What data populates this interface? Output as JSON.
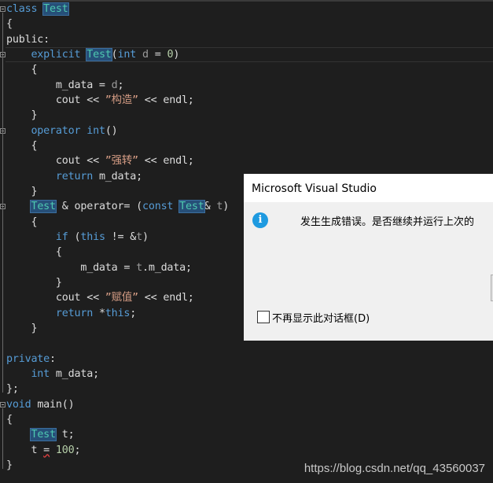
{
  "editor": {
    "lines": [
      [
        [
          "class ",
          "kw"
        ],
        [
          "Test",
          "ty hl"
        ]
      ],
      [
        [
          "{",
          ""
        ]
      ],
      [
        [
          "public",
          ""
        ],
        [
          ":",
          ""
        ]
      ],
      [
        [
          "    explicit ",
          "kw"
        ],
        [
          "Test",
          "ty hl"
        ],
        [
          "(",
          ""
        ],
        [
          "int ",
          "kw"
        ],
        [
          "d",
          "par"
        ],
        [
          " = ",
          ""
        ],
        [
          "0",
          "num"
        ],
        [
          ")",
          ""
        ]
      ],
      [
        [
          "    {",
          ""
        ]
      ],
      [
        [
          "        m_data = ",
          ""
        ],
        [
          "d",
          "par"
        ],
        [
          ";",
          ""
        ]
      ],
      [
        [
          "        cout << ",
          ""
        ],
        [
          "”构造”",
          "str"
        ],
        [
          " << endl;",
          ""
        ]
      ],
      [
        [
          "    }",
          ""
        ]
      ],
      [
        [
          "    operator ",
          "kw"
        ],
        [
          "int",
          "kw"
        ],
        [
          "()",
          ""
        ]
      ],
      [
        [
          "    {",
          ""
        ]
      ],
      [
        [
          "        cout << ",
          ""
        ],
        [
          "”强转”",
          "str"
        ],
        [
          " << endl;",
          ""
        ]
      ],
      [
        [
          "        return ",
          "kw"
        ],
        [
          "m_data;",
          ""
        ]
      ],
      [
        [
          "    }",
          ""
        ]
      ],
      [
        [
          "    ",
          ""
        ],
        [
          "Test",
          "ty hl"
        ],
        [
          " & operator= (",
          ""
        ],
        [
          "const ",
          "kw"
        ],
        [
          "Test",
          "ty hl"
        ],
        [
          "& ",
          ""
        ],
        [
          "t",
          "par"
        ],
        [
          ")",
          ""
        ]
      ],
      [
        [
          "    {",
          ""
        ]
      ],
      [
        [
          "        if ",
          "kw"
        ],
        [
          "(",
          ""
        ],
        [
          "this",
          "kw"
        ],
        [
          " != &",
          ""
        ],
        [
          "t",
          "par"
        ],
        [
          ")",
          ""
        ]
      ],
      [
        [
          "        {",
          ""
        ]
      ],
      [
        [
          "            m_data = ",
          ""
        ],
        [
          "t",
          "par"
        ],
        [
          ".m_data;",
          ""
        ]
      ],
      [
        [
          "        }",
          ""
        ]
      ],
      [
        [
          "        cout << ",
          ""
        ],
        [
          "”赋值”",
          "str"
        ],
        [
          " << endl;",
          ""
        ]
      ],
      [
        [
          "        return ",
          "kw"
        ],
        [
          "*",
          ""
        ],
        [
          "this",
          "kw"
        ],
        [
          ";",
          ""
        ]
      ],
      [
        [
          "    }",
          ""
        ]
      ],
      [
        [
          "",
          ""
        ]
      ],
      [
        [
          "private",
          "kw"
        ],
        [
          ":",
          ""
        ]
      ],
      [
        [
          "    int ",
          "kw"
        ],
        [
          "m_data;",
          ""
        ]
      ],
      [
        [
          "};",
          ""
        ]
      ],
      [
        [
          "void ",
          "kw"
        ],
        [
          "main()",
          ""
        ]
      ],
      [
        [
          "{",
          ""
        ]
      ],
      [
        [
          "    ",
          ""
        ],
        [
          "Test",
          "ty hl"
        ],
        [
          " t;",
          ""
        ]
      ],
      [
        [
          "    t ",
          ""
        ],
        [
          "=",
          "squig"
        ],
        [
          " ",
          ""
        ],
        [
          "100",
          "num"
        ],
        [
          ";",
          ""
        ]
      ],
      [
        [
          "}",
          ""
        ]
      ]
    ]
  },
  "dialog": {
    "title": "Microsoft Visual Studio",
    "message": "发生生成错误。是否继续并运行上次的",
    "checkbox_label": "不再显示此对话框(D)",
    "checked": false
  },
  "watermark": "https://blog.csdn.net/qq_43560037"
}
